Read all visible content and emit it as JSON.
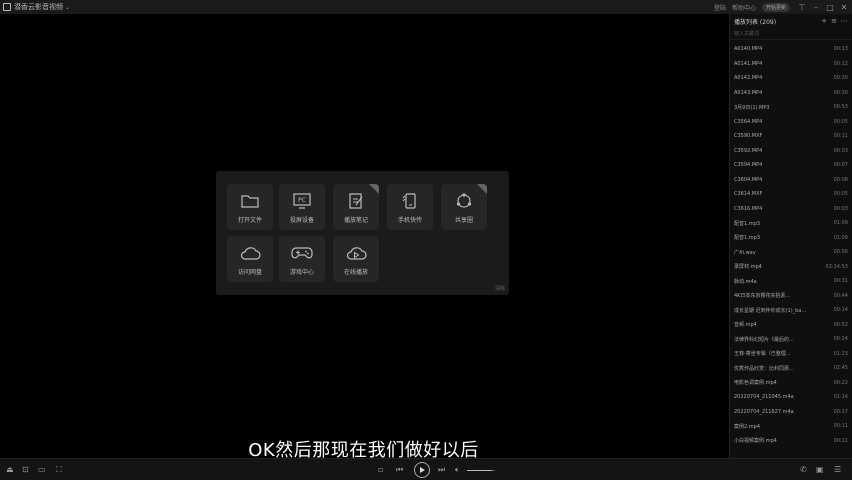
{
  "window": {
    "title": "潜香云影音视频",
    "top_links": [
      "登陆",
      "帮助中心"
    ],
    "top_pill": "开始更新"
  },
  "panel": {
    "tiles": [
      {
        "label": "打开文件",
        "icon": "folder-icon"
      },
      {
        "label": "投屏设备",
        "icon": "pc-cast-icon"
      },
      {
        "label": "播放笔记",
        "icon": "notes-icon",
        "badge": true
      },
      {
        "label": "手机快传",
        "icon": "phone-transfer-icon"
      },
      {
        "label": "共享圈",
        "icon": "share-circle-icon",
        "badge": true
      },
      {
        "label": "访问网盘",
        "icon": "cloud-icon"
      },
      {
        "label": "游戏中心",
        "icon": "gamepad-icon"
      },
      {
        "label": "在线播放",
        "icon": "cloud-play-icon"
      }
    ],
    "note": "清除"
  },
  "subtitle": "OK然后那现在我们做好以后",
  "playlist": {
    "title": "播放列表 (209)",
    "search_placeholder": "输入关键词",
    "items": [
      {
        "name": "A0140.MP4",
        "duration": "00:13"
      },
      {
        "name": "A0141.MP4",
        "duration": "00:12"
      },
      {
        "name": "A0142.MP4",
        "duration": "00:30"
      },
      {
        "name": "A0143.MP4",
        "duration": "00:30"
      },
      {
        "name": "3月9日(1).MP3",
        "duration": "00:53"
      },
      {
        "name": "C3564.MP4",
        "duration": "00:05"
      },
      {
        "name": "C3590.MXF",
        "duration": "00:11"
      },
      {
        "name": "C3592.MP4",
        "duration": "00:03"
      },
      {
        "name": "C3594.MP4",
        "duration": "00:07"
      },
      {
        "name": "C3604.MP4",
        "duration": "00:08"
      },
      {
        "name": "C3614.MXF",
        "duration": "00:05"
      },
      {
        "name": "C3616.MP4",
        "duration": "00:03"
      },
      {
        "name": "配音1.mp3",
        "duration": "01:09"
      },
      {
        "name": "配音1.mp3",
        "duration": "01:09"
      },
      {
        "name": "广州.wav",
        "duration": "00:56"
      },
      {
        "name": "录屏材.mp4",
        "duration": "02:14:53"
      },
      {
        "name": "脉动.m4a",
        "duration": "00:31"
      },
      {
        "name": "4K日本东京樱花实拍素...",
        "duration": "00:44"
      },
      {
        "name": "成长星期 迟到伴你成长(1)_ba...",
        "duration": "00:14"
      },
      {
        "name": "音频.mp4",
        "duration": "00:52"
      },
      {
        "name": "法律界科幻短片《最后的...",
        "duration": "00:24"
      },
      {
        "name": "王菲-乘坐专辑（已整理...",
        "duration": "01:23"
      },
      {
        "name": "优秀作品欣赏：比利同那...",
        "duration": "02:45"
      },
      {
        "name": "电影色调案例.mp4",
        "duration": "00:22"
      },
      {
        "name": "20220704_211045.m4a",
        "duration": "01:14"
      },
      {
        "name": "20220704_211627.m4a",
        "duration": "00:17"
      },
      {
        "name": "案例2.mp4",
        "duration": "00:11"
      },
      {
        "name": "小白视频案例.mp4",
        "duration": "00:11"
      }
    ]
  },
  "controls": {
    "volume_fraction": 0.9
  }
}
